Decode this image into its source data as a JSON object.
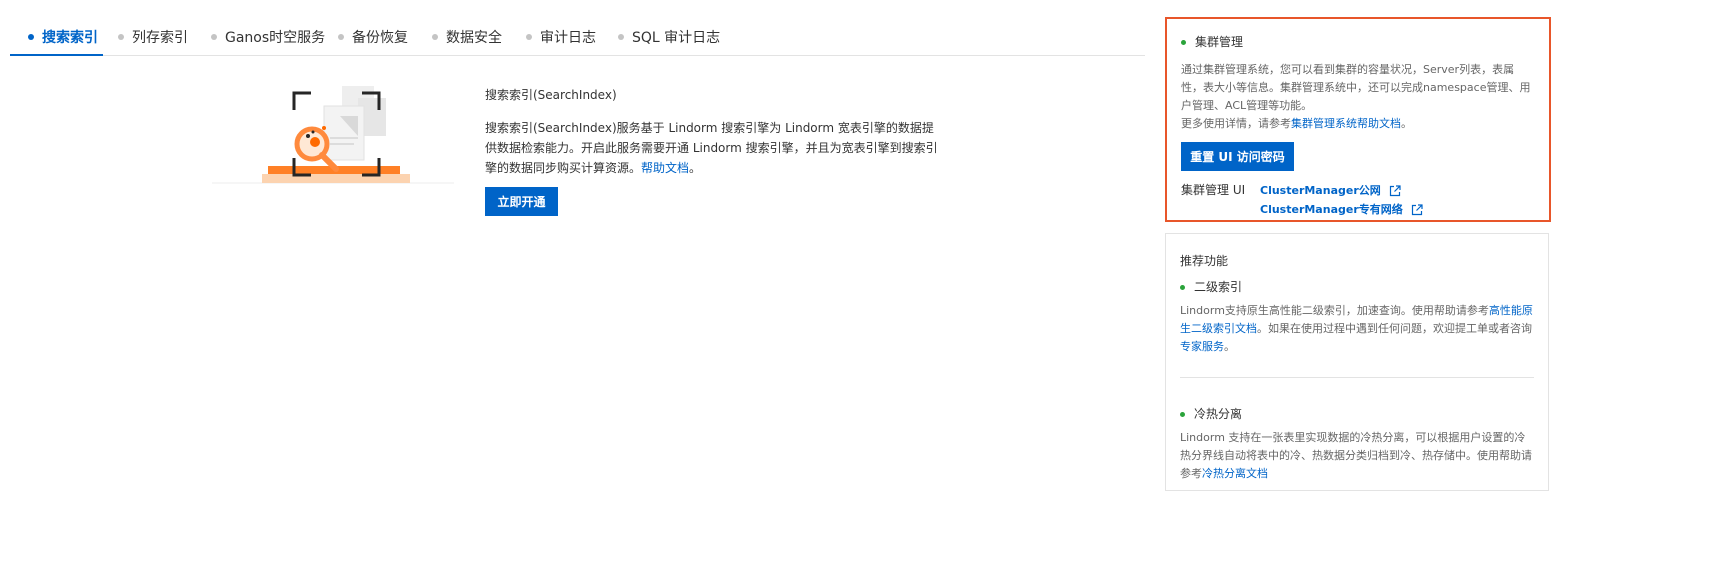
{
  "tabs": [
    {
      "label": "搜索索引",
      "active": true
    },
    {
      "label": "列存索引"
    },
    {
      "label": "Ganos时空服务"
    },
    {
      "label": "备份恢复"
    },
    {
      "label": "数据安全"
    },
    {
      "label": "审计日志"
    },
    {
      "label": "SQL 审计日志"
    }
  ],
  "main": {
    "title": "搜索索引(SearchIndex)",
    "desc": "搜索索引(SearchIndex)服务基于 Lindorm 搜索引擎为 Lindorm 宽表引擎的数据提供数据检索能力。开启此服务需要开通 Lindorm 搜索引擎，并且为宽表引擎到搜索引擎的数据同步购买计算资源。",
    "help_link": "帮助文档",
    "desc_end": "。",
    "open_button": "立即开通"
  },
  "cluster": {
    "title": "集群管理",
    "desc": "通过集群管理系统，您可以看到集群的容量状况，Server列表，表属性，表大小等信息。集群管理系统中，还可以完成namespace管理、用户管理、ACL管理等功能。",
    "more_prefix": "更多使用详情，请参考",
    "more_link": "集群管理系统帮助文档",
    "more_suffix": "。",
    "reset_button": "重置 UI 访问密码",
    "ui_label": "集群管理 UI",
    "link_public": "ClusterManager公网",
    "link_private": "ClusterManager专有网络"
  },
  "recommend": {
    "title": "推荐功能",
    "items": [
      {
        "title": "二级索引",
        "text1": "Lindorm支持原生高性能二级索引，加速查询。使用帮助请参考",
        "link1": "高性能原生二级索引文档",
        "text2": "。如果在使用过程中遇到任何问题，欢迎提工单或者咨询",
        "link2": "专家服务",
        "text3": "。"
      },
      {
        "title": "冷热分离",
        "text1": "Lindorm 支持在一张表里实现数据的冷热分离，可以根据用户设置的冷热分界线自动将表中的冷、热数据分类归档到冷、热存储中。使用帮助请参考",
        "link1": "冷热分离文档"
      }
    ]
  },
  "colors": {
    "accent": "#0064c8",
    "highlight_border": "#e8562a",
    "status_green": "#2aa33a",
    "illustration_orange": "#ff6a00"
  },
  "icons": [
    "search-index-illustration",
    "external-link-icon",
    "status-dot-icon"
  ]
}
